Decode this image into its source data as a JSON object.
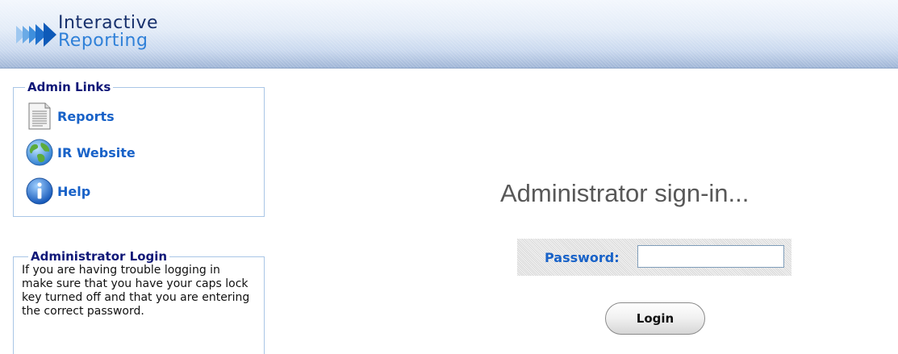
{
  "header": {
    "logo_line1": "Interactive",
    "logo_line2": "Reporting"
  },
  "admin_links": {
    "legend": "Admin Links",
    "items": [
      {
        "label": "Reports",
        "icon": "document-icon"
      },
      {
        "label": "IR Website",
        "icon": "globe-icon"
      },
      {
        "label": "Help",
        "icon": "info-icon"
      }
    ]
  },
  "admin_login": {
    "legend": "Administrator Login",
    "help_text": "If you are having trouble logging in make sure that you have your caps lock key turned off and that you are entering the correct password."
  },
  "signin": {
    "title": "Administrator sign-in...",
    "password_label": "Password:",
    "password_value": "",
    "login_button": "Login"
  },
  "colors": {
    "brand_dark": "#17306c",
    "brand_light": "#2f80d8",
    "link": "#1862c8",
    "legend": "#101878"
  }
}
